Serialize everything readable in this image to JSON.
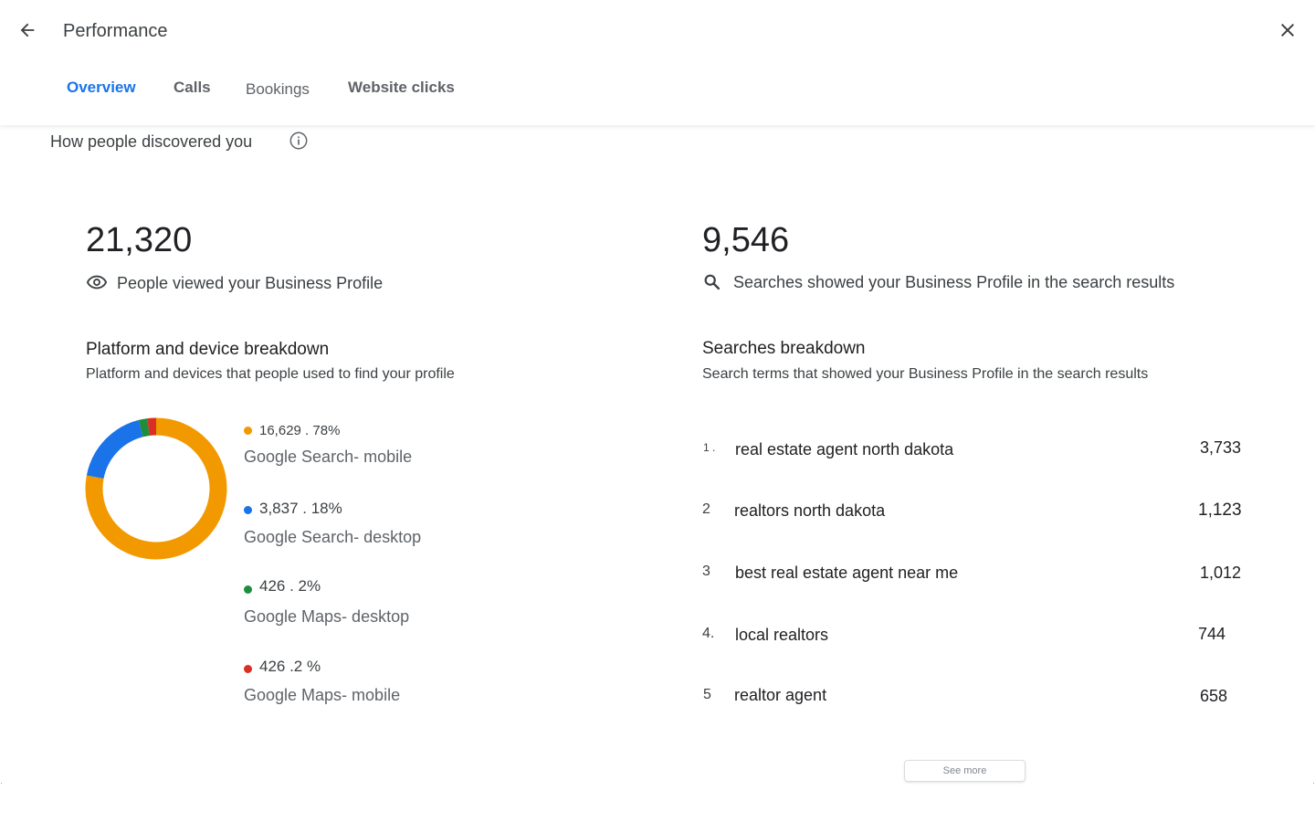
{
  "header": {
    "title": "Performance",
    "tabs": [
      {
        "label": "Overview",
        "active": true
      },
      {
        "label": "Calls"
      },
      {
        "label": "Bookings"
      },
      {
        "label": "Website clicks"
      }
    ]
  },
  "discovery": {
    "title": "How people discovered you",
    "views": {
      "value": "21,320",
      "label": "People viewed your Business Profile"
    },
    "searches": {
      "value": "9,546",
      "label": "Searches showed your Business Profile in the search results"
    }
  },
  "platform": {
    "title": "Platform and device breakdown",
    "subtitle": "Platform and devices that people used to find your profile",
    "items": [
      {
        "value_text": "16,629 . 78%",
        "name": "Google Search- mobile",
        "value": 16629,
        "color": "#f29900"
      },
      {
        "value_text": "3,837 . 18%",
        "name": "Google Search- desktop",
        "value": 3837,
        "color": "#1a73e8"
      },
      {
        "value_text": "426 . 2%",
        "name": "Google Maps- desktop",
        "value": 426,
        "color": "#1e8e3e"
      },
      {
        "value_text": "426 .2 %",
        "name": "Google Maps- mobile",
        "value": 426,
        "color": "#d93025"
      }
    ]
  },
  "searches_breakdown": {
    "title": "Searches breakdown",
    "subtitle": "Search terms that showed your Business Profile in the search results",
    "rows": [
      {
        "rank": "1 .",
        "term": "real estate agent north dakota",
        "count": "3,733"
      },
      {
        "rank": "2",
        "term": "realtors north dakota",
        "count": "1,123"
      },
      {
        "rank": "3",
        "term": "best real estate agent near me",
        "count": "1,012"
      },
      {
        "rank": "4.",
        "term": "local realtors",
        "count": "744"
      },
      {
        "rank": "5",
        "term": "realtor agent",
        "count": "658"
      }
    ],
    "see_more": "See more"
  }
}
